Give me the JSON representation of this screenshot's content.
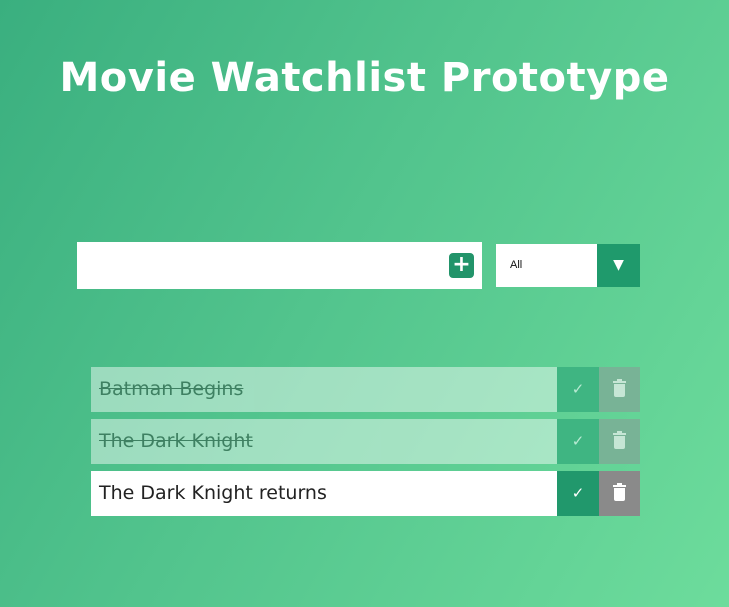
{
  "header": {
    "title": "Movie Watchlist Prototype"
  },
  "add_form": {
    "input_value": "",
    "input_placeholder": "",
    "add_icon": "plus-icon",
    "add_label": "+"
  },
  "filter": {
    "selected": "All",
    "toggle_icon": "triangle-down-icon",
    "toggle_glyph": "▼"
  },
  "movies": [
    {
      "title": "Batman Begins",
      "completed": true
    },
    {
      "title": "The Dark Knight",
      "completed": true
    },
    {
      "title": "The Dark Knight returns",
      "completed": false
    }
  ],
  "icons": {
    "check": "check-icon",
    "check_glyph": "✓",
    "delete": "trash-icon"
  },
  "colors": {
    "accent": "#21986c",
    "delete": "#8a8a8a",
    "background_start": "#3aaf7f",
    "background_end": "#6ddc9c"
  }
}
